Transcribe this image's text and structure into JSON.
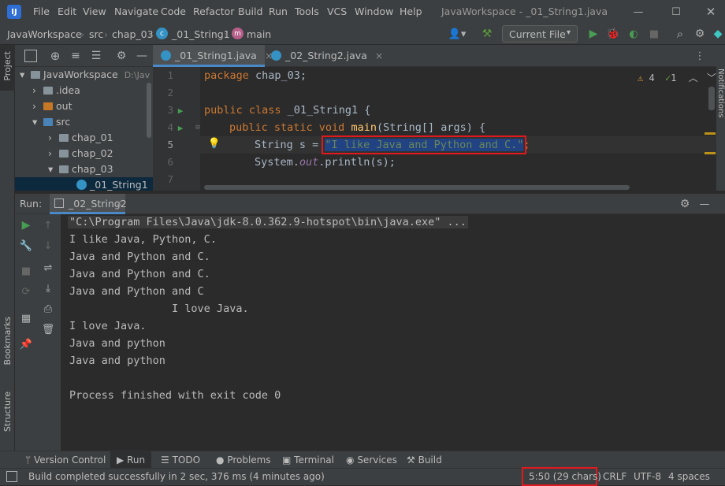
{
  "menu": [
    "File",
    "Edit",
    "View",
    "Navigate",
    "Code",
    "Refactor",
    "Build",
    "Run",
    "Tools",
    "VCS",
    "Window",
    "Help"
  ],
  "window_title": "JavaWorkspace - _01_String1.java",
  "breadcrumb": {
    "project": "JavaWorkspace",
    "src": "src",
    "pkg": "chap_03",
    "cls": "_01_String1",
    "method": "main"
  },
  "run_config": "Current File",
  "project_panel_label": "Project",
  "project_tree": [
    {
      "label": "JavaWorkspace",
      "suffix": "D:\\Jav",
      "indent": 0,
      "arrow": "▾"
    },
    {
      "label": ".idea",
      "indent": 1,
      "arrow": "›"
    },
    {
      "label": "out",
      "indent": 1,
      "arrow": "›"
    },
    {
      "label": "src",
      "indent": 1,
      "arrow": "▾"
    },
    {
      "label": "chap_01",
      "indent": 2,
      "arrow": "›"
    },
    {
      "label": "chap_02",
      "indent": 2,
      "arrow": "›"
    },
    {
      "label": "chap_03",
      "indent": 2,
      "arrow": "▾"
    },
    {
      "label": "_01_String1",
      "indent": 3,
      "arrow": ""
    }
  ],
  "editor_tabs": [
    "_01_String1.java",
    "_02_String2.java"
  ],
  "inspections": {
    "warnings": "4",
    "ok": "1"
  },
  "code_lines": [
    "1",
    "2",
    "3",
    "4",
    "5",
    "6",
    "7"
  ],
  "code": {
    "l1_kw": "package",
    "l1_rest": " chap_03;",
    "l3_kw": "public class",
    "l3_rest": " _01_String1 {",
    "l4_kw": "public static void",
    "l4_fn": "main",
    "l4_rest": "(String[] args) {",
    "l5_pre": "String s = ",
    "l5_str": "\"I like Java and Python and C.\"",
    "l5_post": ";",
    "l6_pre": "System.",
    "l6_it": "out",
    "l6_post": ".println(s);"
  },
  "run_label": "Run:",
  "run_tab": "_02_String2",
  "console": [
    "\"C:\\Program Files\\Java\\jdk-8.0.362.9-hotspot\\bin\\java.exe\" ...",
    "I like Java, Python, C.",
    "Java and Python and C.",
    "Java and Python and C.",
    "Java and Python and C",
    "                I love Java.",
    "I love Java.",
    "Java and python",
    "Java and python",
    "",
    "Process finished with exit code 0"
  ],
  "side_labels": {
    "bookmarks": "Bookmarks",
    "structure": "Structure",
    "notifications": "Notifications"
  },
  "bottom_tabs": [
    "Version Control",
    "Run",
    "TODO",
    "Problems",
    "Terminal",
    "Services",
    "Build"
  ],
  "status": {
    "message": "Build completed successfully in 2 sec, 376 ms (4 minutes ago)",
    "position": "5:50 (29 chars)",
    "line_sep": "CRLF",
    "encoding": "UTF-8",
    "indent": "4 spaces"
  },
  "colors": {
    "highlight_box": "#e0191f",
    "selection": "#214283",
    "accent_green": "#499c54",
    "keyword": "#cc7832",
    "string": "#6a8759"
  }
}
